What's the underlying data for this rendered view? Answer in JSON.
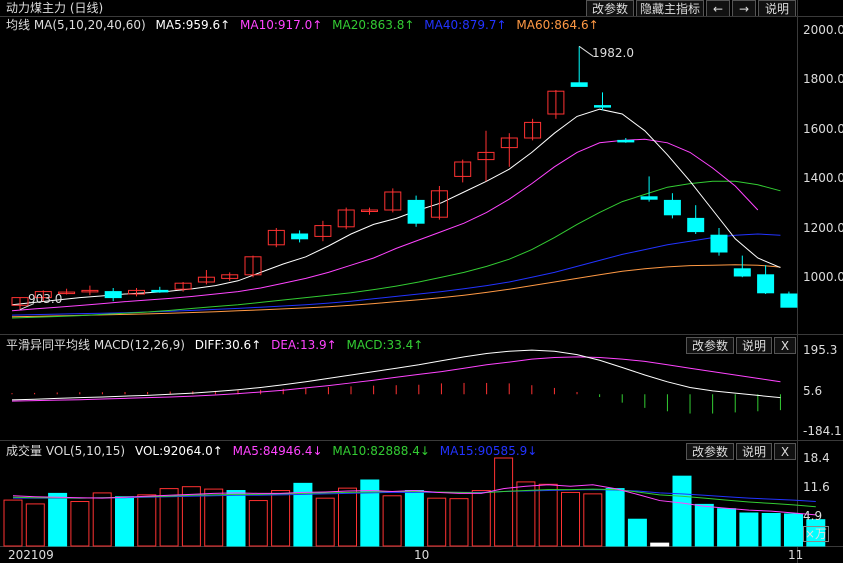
{
  "title": "动力煤主力 (日线)",
  "top_buttons": {
    "params": "改参数",
    "hide_indicator": "隐藏主指标",
    "prev_arrow": "←",
    "next_arrow": "→",
    "help": "说明"
  },
  "ma_header": {
    "label": "均线 MA(5,10,20,40,60)",
    "ma5": "MA5:959.6↑",
    "ma10": "MA10:917.0↑",
    "ma20": "MA20:863.8↑",
    "ma40": "MA40:879.7↑",
    "ma60": "MA60:864.6↑"
  },
  "macd_header": {
    "label": "平滑异同平均线 MACD(12,26,9)",
    "diff": "DIFF:30.6↑",
    "dea": "DEA:13.9↑",
    "macd": "MACD:33.4↑",
    "params": "改参数",
    "help": "说明",
    "close": "X"
  },
  "vol_header": {
    "label": "成交量 VOL(5,10,15)",
    "vol": "VOL:92064.0↑",
    "ma5": "MA5:84946.4↓",
    "ma10": "MA10:82888.4↓",
    "ma15": "MA15:90585.9↓",
    "params": "改参数",
    "help": "说明",
    "close": "X"
  },
  "price_axis": [
    "2000.0",
    "1800.0",
    "1600.0",
    "1400.0",
    "1200.0",
    "1000.0"
  ],
  "macd_axis": [
    "195.3",
    "5.6",
    "-184.1"
  ],
  "vol_axis": [
    "18.4",
    "11.6",
    "4.9"
  ],
  "vol_unit": "×万",
  "time_axis": [
    "202109",
    "10",
    "11"
  ],
  "annotations": {
    "high": "1982.0",
    "low": "903.0"
  },
  "colors": {
    "up": "#ff3232",
    "down": "#00ffff",
    "ma5": "#ffffff",
    "ma10": "#ff44ff",
    "ma20": "#33cc33",
    "ma40": "#2233ff",
    "ma60": "#ff9944"
  },
  "chart_data": {
    "type": "candlestick",
    "candles": [
      {
        "o": 903,
        "h": 930,
        "l": 885,
        "c": 935
      },
      {
        "o": 935,
        "h": 965,
        "l": 920,
        "c": 960
      },
      {
        "o": 955,
        "h": 972,
        "l": 948,
        "c": 958
      },
      {
        "o": 960,
        "h": 985,
        "l": 945,
        "c": 965
      },
      {
        "o": 960,
        "h": 975,
        "l": 920,
        "c": 935
      },
      {
        "o": 950,
        "h": 975,
        "l": 940,
        "c": 965
      },
      {
        "o": 965,
        "h": 980,
        "l": 955,
        "c": 960
      },
      {
        "o": 970,
        "h": 1000,
        "l": 960,
        "c": 995
      },
      {
        "o": 1000,
        "h": 1050,
        "l": 990,
        "c": 1020
      },
      {
        "o": 1015,
        "h": 1040,
        "l": 1005,
        "c": 1030
      },
      {
        "o": 1030,
        "h": 1110,
        "l": 1020,
        "c": 1105
      },
      {
        "o": 1155,
        "h": 1225,
        "l": 1145,
        "c": 1215
      },
      {
        "o": 1200,
        "h": 1215,
        "l": 1165,
        "c": 1180
      },
      {
        "o": 1190,
        "h": 1255,
        "l": 1170,
        "c": 1235
      },
      {
        "o": 1230,
        "h": 1310,
        "l": 1220,
        "c": 1300
      },
      {
        "o": 1295,
        "h": 1310,
        "l": 1280,
        "c": 1300
      },
      {
        "o": 1300,
        "h": 1390,
        "l": 1290,
        "c": 1375
      },
      {
        "o": 1340,
        "h": 1360,
        "l": 1230,
        "c": 1245
      },
      {
        "o": 1270,
        "h": 1400,
        "l": 1260,
        "c": 1380
      },
      {
        "o": 1440,
        "h": 1510,
        "l": 1415,
        "c": 1500
      },
      {
        "o": 1510,
        "h": 1630,
        "l": 1420,
        "c": 1540
      },
      {
        "o": 1560,
        "h": 1620,
        "l": 1480,
        "c": 1600
      },
      {
        "o": 1600,
        "h": 1680,
        "l": 1590,
        "c": 1665
      },
      {
        "o": 1700,
        "h": 1800,
        "l": 1680,
        "c": 1795
      },
      {
        "o": 1830,
        "h": 1982,
        "l": 1815,
        "c": 1815
      },
      {
        "o": 1735,
        "h": 1790,
        "l": 1715,
        "c": 1730
      },
      {
        "o": 1590,
        "h": 1600,
        "l": 1580,
        "c": 1585
      },
      {
        "o": 1355,
        "h": 1440,
        "l": 1335,
        "c": 1345
      },
      {
        "o": 1340,
        "h": 1370,
        "l": 1265,
        "c": 1280
      },
      {
        "o": 1265,
        "h": 1320,
        "l": 1200,
        "c": 1210
      },
      {
        "o": 1195,
        "h": 1225,
        "l": 1110,
        "c": 1125
      },
      {
        "o": 1055,
        "h": 1110,
        "l": 1020,
        "c": 1025
      },
      {
        "o": 1030,
        "h": 1070,
        "l": 950,
        "c": 955
      },
      {
        "o": 950,
        "h": 960,
        "l": 900,
        "c": 895
      }
    ],
    "ma5": [
      905,
      915,
      925,
      935,
      942,
      950,
      955,
      962,
      972,
      985,
      1005,
      1040,
      1075,
      1105,
      1150,
      1200,
      1240,
      1265,
      1300,
      1330,
      1375,
      1420,
      1470,
      1540,
      1620,
      1690,
      1720,
      1700,
      1630,
      1530,
      1420,
      1300,
      1180,
      1100,
      1060
    ],
    "ma10": [
      880,
      888,
      895,
      902,
      910,
      918,
      925,
      932,
      940,
      950,
      960,
      975,
      995,
      1015,
      1040,
      1070,
      1100,
      1140,
      1175,
      1210,
      1245,
      1290,
      1345,
      1410,
      1480,
      1540,
      1580,
      1590,
      1595,
      1580,
      1540,
      1475,
      1400,
      1300
    ],
    "ma20": [
      850,
      853,
      856,
      860,
      865,
      870,
      875,
      882,
      890,
      898,
      905,
      915,
      925,
      935,
      945,
      955,
      968,
      983,
      1000,
      1020,
      1040,
      1065,
      1095,
      1135,
      1185,
      1240,
      1290,
      1335,
      1365,
      1395,
      1410,
      1420,
      1420,
      1405,
      1380
    ],
    "ma40": [
      862,
      864,
      866,
      868,
      870,
      872,
      875,
      878,
      882,
      886,
      890,
      895,
      900,
      905,
      912,
      920,
      930,
      940,
      950,
      960,
      972,
      985,
      1000,
      1020,
      1040,
      1065,
      1090,
      1115,
      1135,
      1155,
      1170,
      1185,
      1195,
      1200,
      1195
    ],
    "ma60": [
      855,
      857,
      859,
      861,
      863,
      865,
      867,
      870,
      873,
      876,
      880,
      884,
      888,
      892,
      897,
      903,
      910,
      918,
      926,
      935,
      945,
      957,
      970,
      985,
      1000,
      1015,
      1030,
      1045,
      1055,
      1063,
      1068,
      1070,
      1072,
      1070,
      1062
    ],
    "macd_diff": [
      -25,
      -22,
      -18,
      -15,
      -12,
      -8,
      -5,
      0,
      5,
      12,
      20,
      30,
      42,
      55,
      70,
      85,
      100,
      115,
      130,
      148,
      165,
      180,
      190,
      195,
      190,
      175,
      150,
      118,
      85,
      55,
      30,
      15,
      5,
      -5,
      -15
    ],
    "macd_dea": [
      -30,
      -28,
      -26,
      -24,
      -21,
      -18,
      -15,
      -12,
      -8,
      -3,
      3,
      10,
      18,
      28,
      38,
      50,
      62,
      75,
      88,
      100,
      115,
      130,
      142,
      155,
      162,
      165,
      162,
      155,
      145,
      130,
      115,
      100,
      85,
      70,
      55
    ],
    "macd_hist": [
      5,
      6,
      8,
      9,
      9,
      10,
      10,
      12,
      13,
      15,
      17,
      20,
      24,
      27,
      32,
      35,
      38,
      40,
      42,
      48,
      50,
      50,
      48,
      40,
      28,
      10,
      -12,
      -37,
      -60,
      -75,
      -85,
      -85,
      -80,
      -75,
      -70
    ],
    "volume": [
      9.6,
      8.8,
      11.0,
      9.3,
      11.1,
      10.3,
      10.7,
      12.0,
      12.4,
      11.9,
      11.6,
      9.5,
      11.6,
      13.1,
      10.0,
      12.1,
      13.8,
      10.5,
      11.6,
      10.0,
      9.9,
      11.6,
      18.4,
      13.4,
      12.9,
      11.2,
      10.9,
      12.0,
      5.6,
      0.6,
      14.6,
      8.7,
      7.8,
      6.9,
      6.8,
      6.7,
      5.5
    ],
    "vol_dir": [
      1,
      1,
      0,
      1,
      1,
      0,
      1,
      1,
      1,
      1,
      0,
      1,
      1,
      0,
      1,
      1,
      0,
      1,
      0,
      1,
      1,
      1,
      1,
      1,
      1,
      1,
      1,
      0,
      0,
      2,
      0,
      0,
      0,
      0,
      0,
      0,
      0
    ],
    "vol_ma5": [
      10.5,
      10.3,
      10.2,
      10.1,
      10.0,
      10.2,
      10.4,
      10.6,
      10.8,
      11.0,
      11.1,
      11.0,
      11.0,
      11.2,
      11.3,
      11.5,
      11.6,
      11.4,
      11.6,
      11.2,
      11.0,
      11.0,
      12.0,
      12.5,
      12.8,
      12.5,
      12.8,
      12.0,
      10.8,
      9.5,
      9.0,
      8.3,
      7.9,
      7.5,
      7.3,
      6.9,
      6.5
    ],
    "vol_ma10": [
      10.2,
      10.1,
      10.1,
      10.0,
      10.1,
      10.2,
      10.3,
      10.4,
      10.6,
      10.7,
      10.8,
      10.8,
      10.9,
      11.0,
      11.1,
      11.2,
      11.3,
      11.4,
      11.4,
      11.3,
      11.2,
      11.1,
      11.4,
      11.6,
      11.8,
      11.8,
      11.9,
      11.8,
      11.3,
      10.7,
      10.4,
      10.0,
      9.6,
      9.2,
      8.9,
      8.6,
      8.2
    ],
    "vol_ma15": [
      10.0,
      10.0,
      10.0,
      10.0,
      10.1,
      10.1,
      10.2,
      10.3,
      10.4,
      10.5,
      10.6,
      10.6,
      10.7,
      10.8,
      10.9,
      11.0,
      11.1,
      11.2,
      11.2,
      11.2,
      11.2,
      11.2,
      11.4,
      11.5,
      11.6,
      11.7,
      11.8,
      11.7,
      11.5,
      11.1,
      10.9,
      10.6,
      10.3,
      10.0,
      9.8,
      9.6,
      9.3
    ],
    "price_range": [
      800,
      2050
    ],
    "macd_range": [
      -184.1,
      195.3
    ],
    "vol_range": [
      0,
      18.4
    ]
  }
}
